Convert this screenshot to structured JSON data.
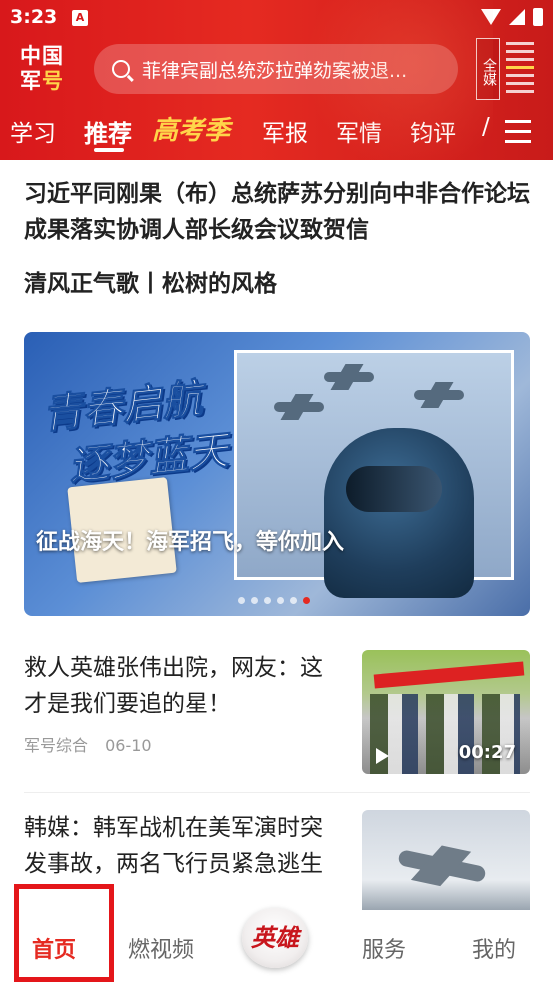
{
  "status": {
    "time": "3:23",
    "app_badge": "A"
  },
  "header": {
    "logo_line1": "中国",
    "logo_line2a": "军",
    "logo_line2b": "号",
    "search_placeholder": "菲律宾副总统莎拉弹劾案被退...",
    "media_label": "全媒"
  },
  "tabs": [
    {
      "label": "学习"
    },
    {
      "label": "推荐"
    },
    {
      "label": "高考季"
    },
    {
      "label": "军报"
    },
    {
      "label": "军情"
    },
    {
      "label": "钧评"
    },
    {
      "label": "/"
    }
  ],
  "feed": {
    "headline": "习近平同刚果（布）总统萨苏分别向中非合作论坛成果落实协调人部长级会议致贺信",
    "headline2": "清风正气歌丨松树的风格",
    "banner": {
      "title_line1": "青春启航",
      "title_line2": "逐梦蓝天",
      "caption": "征战海天！海军招飞，等你加入",
      "slide_count": 6,
      "active_slide": 6
    },
    "news1": {
      "title": "救人英雄张伟出院，网友：这才是我们要追的星！",
      "source": "军号综合",
      "date": "06-10",
      "duration": "00:27"
    },
    "news2": {
      "title": "韩媒：韩军战机在美军演时突发事故，两名飞行员紧急逃生"
    }
  },
  "bottom_nav": [
    {
      "label": "首页"
    },
    {
      "label": "燃视频"
    },
    {
      "label": "英雄"
    },
    {
      "label": "服务"
    },
    {
      "label": "我的"
    }
  ],
  "colors": {
    "brand_red": "#e52a21",
    "accent_yellow": "#ffd54a",
    "highlight_box": "#e4161a"
  }
}
